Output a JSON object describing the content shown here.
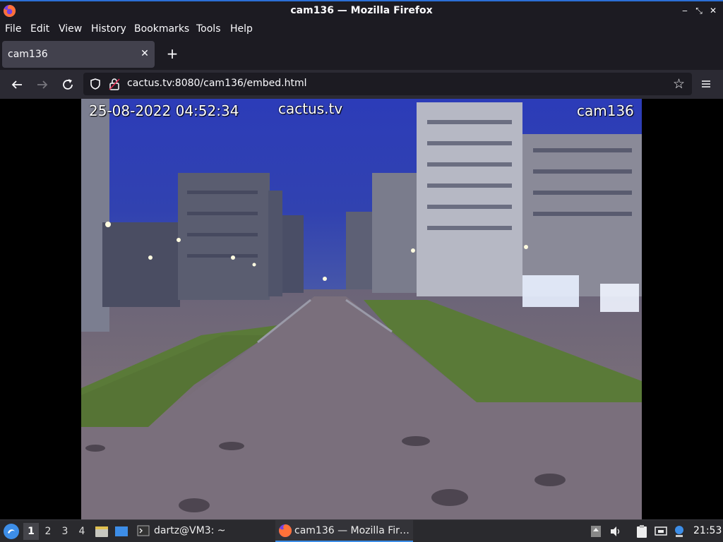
{
  "window": {
    "title": "cam136 — Mozilla Firefox"
  },
  "menu": [
    "File",
    "Edit",
    "View",
    "History",
    "Bookmarks",
    "Tools",
    "Help"
  ],
  "tab": {
    "label": "cam136"
  },
  "address": {
    "url": "cactus.tv:8080/cam136/embed.html"
  },
  "camera": {
    "timestamp": "25-08-2022 04:52:34",
    "brand": "cactus.tv",
    "name": "cam136"
  },
  "taskbar": {
    "workspaces": [
      "1",
      "2",
      "3",
      "4"
    ],
    "active_workspace": "1",
    "tasks": [
      {
        "label": "dartz@VM3: ~",
        "icon": "terminal-icon"
      },
      {
        "label": "cam136 — Mozilla Fir…",
        "icon": "firefox-icon"
      }
    ],
    "clock": "21:53"
  },
  "colors": {
    "accent": "#2b6fd6",
    "browser_bg": "#1c1b22",
    "toolbar_bg": "#2b2a33",
    "tab_active": "#42414d"
  }
}
